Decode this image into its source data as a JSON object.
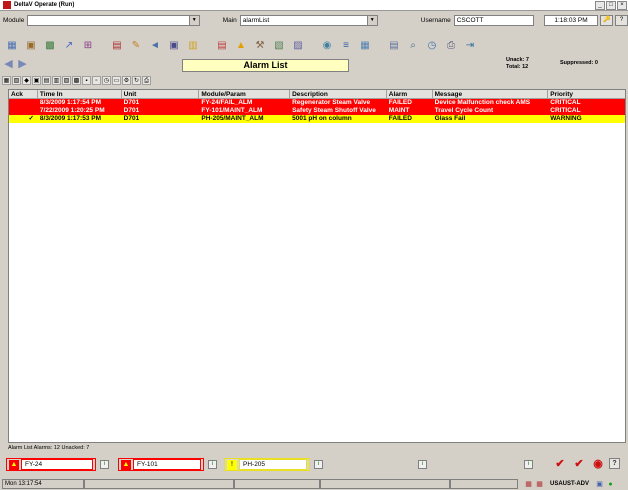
{
  "window": {
    "title": "DeltaV Operate (Run)",
    "buttons": [
      "_",
      "□",
      "×"
    ]
  },
  "header": {
    "module_label": "Module",
    "module_value": "",
    "main_label": "Main",
    "main_value": "alarmList",
    "username_label": "Username",
    "username_value": "CSCOTT",
    "time": "1:18:03 PM",
    "key_icon": "🔑",
    "help_icon": "?"
  },
  "toolbar": [
    {
      "name": "faceplate-icon",
      "glyph": "▦",
      "color": "#4a6fb3"
    },
    {
      "name": "detail-icon",
      "glyph": "▣",
      "color": "#9a6a2a"
    },
    {
      "name": "process-graphics-icon",
      "glyph": "▩",
      "color": "#3a7a3a"
    },
    {
      "name": "trend-icon",
      "glyph": "↗",
      "color": "#4060c0"
    },
    {
      "name": "diagnostics-icon",
      "glyph": "⊞",
      "color": "#8a3a8a"
    },
    {
      "name": "book-icon",
      "glyph": "▤",
      "color": "#b03030"
    },
    {
      "name": "pencil-icon",
      "glyph": "✎",
      "color": "#c08020"
    },
    {
      "name": "nav-back-icon",
      "glyph": "◄",
      "color": "#4a70a8"
    },
    {
      "name": "window-icon",
      "glyph": "▣",
      "color": "#4a4a8a"
    },
    {
      "name": "folder-icon",
      "glyph": "▥",
      "color": "#d0a020"
    },
    {
      "name": "chart-icon",
      "glyph": "▤",
      "color": "#c04040"
    },
    {
      "name": "warning-icon",
      "glyph": "▲",
      "color": "#e0a000"
    },
    {
      "name": "tools-icon",
      "glyph": "⚒",
      "color": "#806040"
    },
    {
      "name": "picture-icon",
      "glyph": "▧",
      "color": "#508050"
    },
    {
      "name": "edit-icon",
      "glyph": "▨",
      "color": "#6060a0"
    },
    {
      "name": "globe-icon",
      "glyph": "◉",
      "color": "#4080a0"
    },
    {
      "name": "list-icon",
      "glyph": "≡",
      "color": "#3060a0"
    },
    {
      "name": "grid-icon",
      "glyph": "▦",
      "color": "#5080b0"
    },
    {
      "name": "clipboard-icon",
      "glyph": "▤",
      "color": "#6070a0"
    },
    {
      "name": "search-icon",
      "glyph": "⌕",
      "color": "#407090"
    },
    {
      "name": "clock-icon",
      "glyph": "◷",
      "color": "#4070b0"
    },
    {
      "name": "printer-icon",
      "glyph": "⎙",
      "color": "#5a5a7a"
    },
    {
      "name": "exit-icon",
      "glyph": "⇥",
      "color": "#3070a0"
    }
  ],
  "nav": {
    "title": "Alarm List",
    "unack_label": "Unack:",
    "unack_value": "7",
    "total_label": "Total:",
    "total_value": "12",
    "suppressed_label": "Suppressed:",
    "suppressed_value": "0"
  },
  "filters": [
    {
      "name": "filter-all-icon",
      "glyph": "▦"
    },
    {
      "name": "filter-unack-icon",
      "glyph": "▧"
    },
    {
      "name": "filter-critical-icon",
      "glyph": "◆"
    },
    {
      "name": "filter-high-icon",
      "glyph": "▣"
    },
    {
      "name": "filter-medium-icon",
      "glyph": "▤"
    },
    {
      "name": "filter-low-icon",
      "glyph": "▥"
    },
    {
      "name": "filter-area-icon",
      "glyph": "▨"
    },
    {
      "name": "filter-unit-icon",
      "glyph": "▩"
    },
    {
      "name": "filter-module-icon",
      "glyph": "▪"
    },
    {
      "name": "filter-priority-icon",
      "glyph": "▫"
    },
    {
      "name": "filter-time-icon",
      "glyph": "◷"
    },
    {
      "name": "filter-type-icon",
      "glyph": "▭"
    },
    {
      "name": "filter-settings-icon",
      "glyph": "⚙"
    },
    {
      "name": "filter-refresh-icon",
      "glyph": "↻"
    },
    {
      "name": "filter-print-icon",
      "glyph": "⎙"
    }
  ],
  "alarm_list": {
    "columns": [
      "Ack",
      "Time In",
      "Unit",
      "Module/Param",
      "Description",
      "Alarm",
      "Message",
      "Priority"
    ],
    "rows": [
      {
        "ack": "",
        "time": "8/3/2009 1:17:54 PM",
        "unit": "D701",
        "module": "FY-24/FAIL_ALM",
        "description": "Regenerator Steam Valve",
        "alarm": "FAILED",
        "message": "Device Malfunction check AMS",
        "priority": "CRITICAL",
        "bg": "#ff0000",
        "fg": "#ffffff"
      },
      {
        "ack": "",
        "time": "7/22/2009 1:20:25 PM",
        "unit": "D701",
        "module": "FY-101/MAINT_ALM",
        "description": "Safety Steam Shutoff Valve",
        "alarm": "MAINT",
        "message": "Travel Cycle Count",
        "priority": "CRITICAL",
        "bg": "#ff0000",
        "fg": "#ffffff"
      },
      {
        "ack": "✓",
        "time": "8/3/2009 1:17:53 PM",
        "unit": "D701",
        "module": "PH-205/MAINT_ALM",
        "description": "5001 pH on column",
        "alarm": "FAILED",
        "message": "Glass Fail",
        "priority": "WARNING",
        "bg": "#ffff00",
        "fg": "#000000"
      }
    ]
  },
  "status": {
    "summary": "Alarm List  Alarms: 12  Unacked: 7"
  },
  "horn_bar": [
    {
      "tag": "FY-24",
      "border": "#ff0000",
      "bell_bg": "#ff0000",
      "bell_fg": "#ffff00",
      "bell": "▲"
    },
    {
      "tag": "FY-101",
      "border": "#ff0000",
      "bell_bg": "#ff0000",
      "bell_fg": "#ffff00",
      "bell": "▲"
    },
    {
      "tag": "PH-205",
      "border": "#e8e020",
      "bell_bg": "#ffff00",
      "bell_fg": "#000000",
      "bell": "!"
    }
  ],
  "footer": {
    "datetime": "Mon 13:17:54",
    "workstation": "USAUST-ADV"
  }
}
